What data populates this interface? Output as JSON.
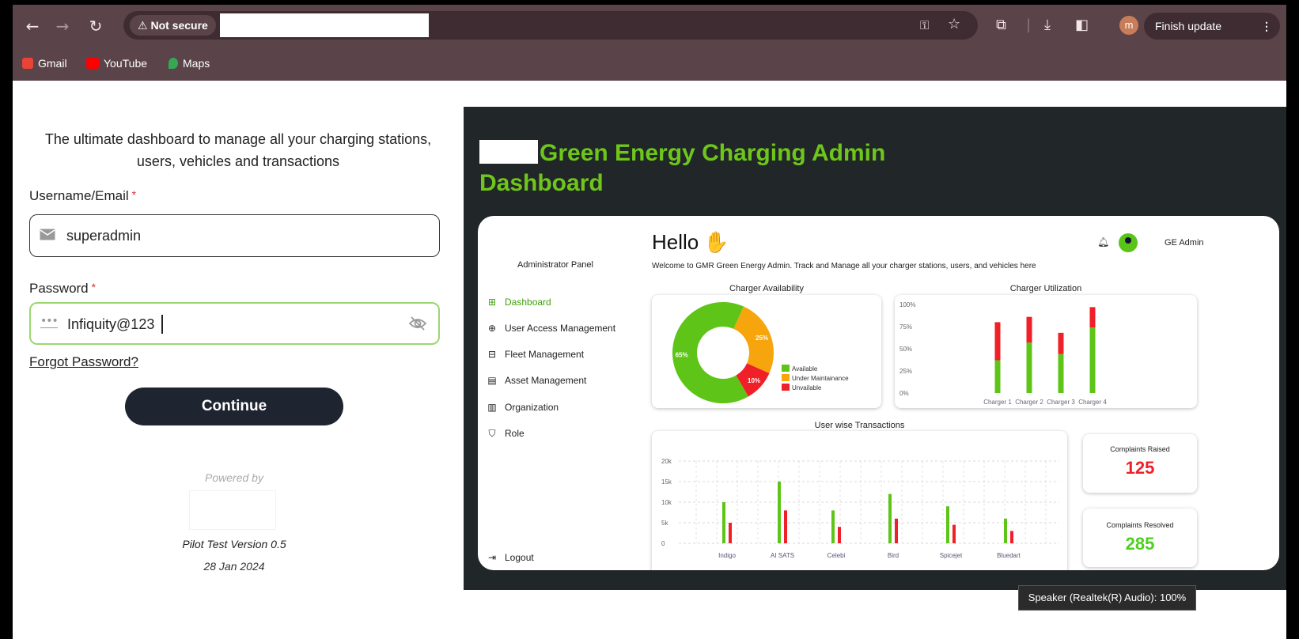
{
  "browser": {
    "not_secure": "Not secure",
    "finish_update": "Finish update",
    "profile_initial": "m",
    "bookmarks": [
      {
        "label": "Gmail"
      },
      {
        "label": "YouTube"
      },
      {
        "label": "Maps"
      }
    ]
  },
  "login": {
    "tagline": "The ultimate dashboard to manage all your charging stations, users, vehicles and transactions",
    "username_label": "Username/Email",
    "username_value": "superadmin",
    "password_label": "Password",
    "password_value": "Infiquity@123",
    "required_mark": "*",
    "forgot": "Forgot Password?",
    "continue": "Continue",
    "powered_by": "Powered by",
    "version": "Pilot Test Version 0.5",
    "date": "28 Jan 2024"
  },
  "hero": {
    "title": "Green Energy Charging Admin Dashboard",
    "dashboard": {
      "panel_title": "Administrator Panel",
      "menu": [
        {
          "label": "Dashboard",
          "icon": "grid-icon"
        },
        {
          "label": "User Access Management",
          "icon": "globe-icon"
        },
        {
          "label": "Fleet Management",
          "icon": "car-icon"
        },
        {
          "label": "Asset Management",
          "icon": "asset-icon"
        },
        {
          "label": "Organization",
          "icon": "building-icon"
        },
        {
          "label": "Role",
          "icon": "shield-icon"
        }
      ],
      "logout": "Logout",
      "hello": "Hello",
      "welcome": "Welcome to GMR Green Energy Admin. Track and Manage all your charger stations, users, and vehicles here",
      "admin_name": "GE Admin",
      "availability": {
        "title": "Charger Availability",
        "slices": [
          {
            "label": "65%",
            "value": 65,
            "color": "#5ec518"
          },
          {
            "label": "25%",
            "value": 25,
            "color": "#f6a50d"
          },
          {
            "label": "10%",
            "value": 10,
            "color": "#ef2027"
          }
        ],
        "legend": [
          "Available",
          "Under Maintainance",
          "Unvailable"
        ]
      },
      "utilization": {
        "title": "Charger Utilization",
        "ticks": [
          "100%",
          "75%",
          "50%",
          "25%",
          "0%"
        ],
        "categories": [
          "Charger 1",
          "Charger 2",
          "Charger 3",
          "Charger 4"
        ],
        "green": [
          37,
          57,
          44,
          74
        ],
        "red": [
          43,
          29,
          24,
          23
        ]
      },
      "transactions": {
        "title": "User wise Transactions",
        "ticks": [
          "20k",
          "15k",
          "10k",
          "5k",
          "0"
        ],
        "categories": [
          "Indigo",
          "AI SATS",
          "Celebi",
          "Bird",
          "Spicejet",
          "Bluedart"
        ],
        "green": [
          10000,
          15000,
          8000,
          12000,
          9000,
          6000
        ],
        "red": [
          5000,
          8000,
          4000,
          6000,
          4500,
          3000
        ]
      },
      "complaints_raised": {
        "label": "Complaints Raised",
        "value": "125"
      },
      "complaints_resolved": {
        "label": "Complaints Resolved",
        "value": "285"
      }
    }
  },
  "tooltip": "Speaker (Realtek(R) Audio): 100%",
  "colors": {
    "chrome": "#5b434a",
    "brand_green": "#6ec61b",
    "hero_bg": "#212629",
    "red": "#ef2027",
    "orange": "#f6a50d"
  }
}
